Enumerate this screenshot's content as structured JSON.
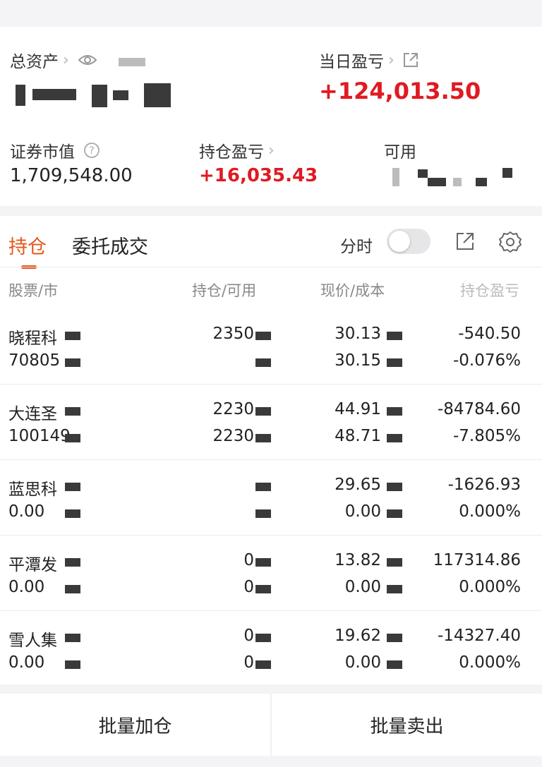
{
  "summary": {
    "total_assets_label": "总资产",
    "daily_pnl_label": "当日盈亏",
    "daily_pnl_value": "+124,013.50",
    "market_value_label": "证券市值",
    "market_value": "1,709,548.00",
    "holding_pnl_label": "持仓盈亏",
    "holding_pnl_value": "+16,035.43",
    "available_label": "可用"
  },
  "tabs": {
    "holdings": "持仓",
    "orders": "委托成交",
    "intraday_label": "分时"
  },
  "table": {
    "headers": [
      "股票/市",
      "持仓/可用",
      "现价/成本",
      "持仓盈亏"
    ],
    "rows": [
      {
        "name": "晓程科",
        "code": "70805",
        "qty": "2350",
        "avail": "",
        "price": "30.13",
        "cost": "30.15",
        "pnl": "-540.50",
        "pnl_pct": "-0.076%",
        "tone": "green"
      },
      {
        "name": "大连圣",
        "code": "100149",
        "qty": "2230",
        "avail": "2230",
        "price": "44.91",
        "cost": "48.71",
        "pnl": "-84784.60",
        "pnl_pct": "-7.805%",
        "tone": "green"
      },
      {
        "name": "蓝思科",
        "code": "0.00",
        "qty": "",
        "avail": "",
        "price": "29.65",
        "cost": "0.00",
        "pnl": "-1626.93",
        "pnl_pct": "0.000%",
        "tone": "green"
      },
      {
        "name": "平潭发",
        "code": "0.00",
        "qty": "0",
        "avail": "0",
        "price": "13.82",
        "cost": "0.00",
        "pnl": "117314.86",
        "pnl_pct": "0.000%",
        "tone": "red"
      },
      {
        "name": "雪人集",
        "code": "0.00",
        "qty": "0",
        "avail": "0",
        "price": "19.62",
        "cost": "0.00",
        "pnl": "-14327.40",
        "pnl_pct": "0.000%",
        "tone": "green"
      }
    ]
  },
  "actions": {
    "batch_add": "批量加仓",
    "batch_sell": "批量卖出"
  },
  "colors": {
    "accent": "#e4571d",
    "gain": "#e01a22",
    "loss": "#3ea53b"
  }
}
